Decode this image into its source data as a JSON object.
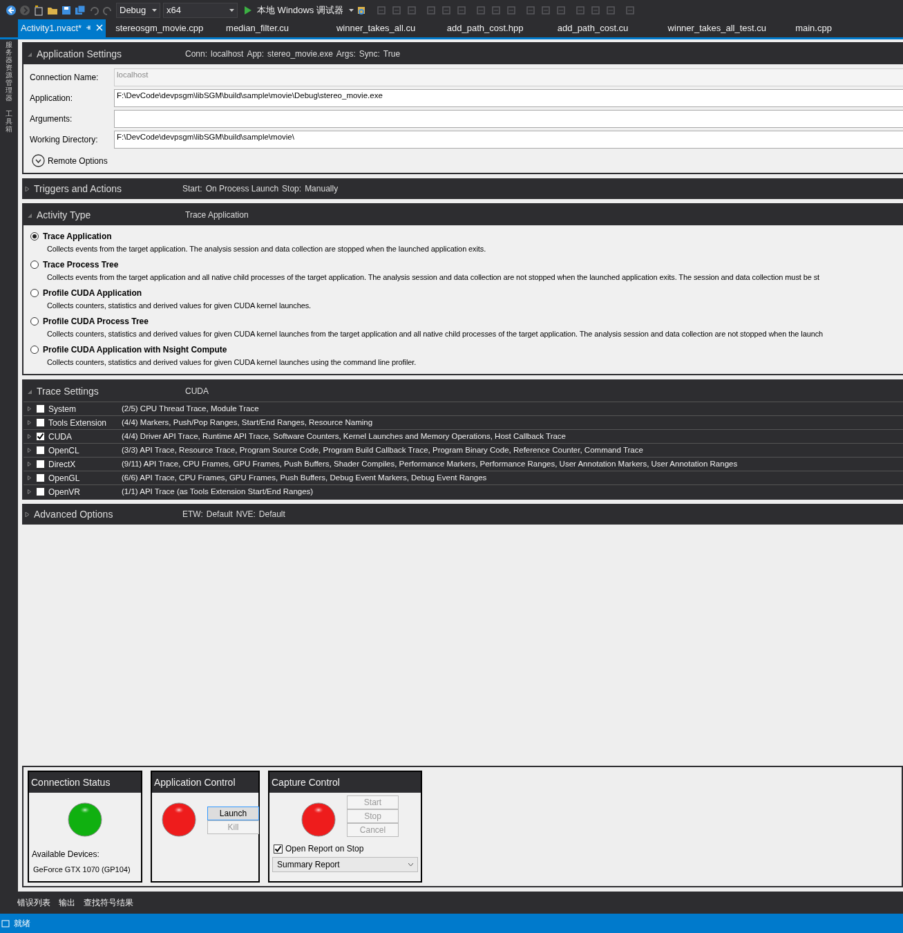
{
  "toolbar": {
    "configuration": "Debug",
    "platform": "x64",
    "debugger": "本地 Windows 调试器"
  },
  "side_panels": [
    "服务器资源管理器",
    "工具箱"
  ],
  "tabs": [
    {
      "label": "Activity1.nvact*",
      "selected": true
    },
    {
      "label": "stereosgm_movie.cpp",
      "selected": false
    },
    {
      "label": "median_filter.cu",
      "selected": false
    },
    {
      "label": "winner_takes_all.cu",
      "selected": false
    },
    {
      "label": "add_path_cost.hpp",
      "selected": false
    },
    {
      "label": "add_path_cost.cu",
      "selected": false
    },
    {
      "label": "winner_takes_all_test.cu",
      "selected": false
    },
    {
      "label": "main.cpp",
      "selected": false
    }
  ],
  "sections": [
    {
      "kind": "settings",
      "title": "Application Settings",
      "expanded": true,
      "summary": [
        {
          "label": "Conn:",
          "value": "localhost"
        },
        {
          "label": "App:",
          "value": "stereo_movie.exe"
        },
        {
          "label": "Args:"
        },
        {
          "label": "Sync:",
          "value": "True"
        }
      ],
      "fields": [
        {
          "label": "Connection Name:",
          "value": "localhost",
          "disabled": true
        },
        {
          "label": "Application:",
          "value": "F:\\DevCode\\devpsgm\\libSGM\\build\\sample\\movie\\Debug\\stereo_movie.exe",
          "disabled": false
        },
        {
          "label": "Arguments:",
          "disabled": false
        },
        {
          "label": "Working Directory:",
          "value": "F:\\DevCode\\devpsgm\\libSGM\\build\\sample\\movie\\",
          "disabled": false
        }
      ],
      "remote_options": {
        "label": "Remote Options",
        "expanded": false
      }
    },
    {
      "kind": "collapsed",
      "title": "Triggers and Actions",
      "expanded": false,
      "summary": [
        {
          "label": "Start:",
          "value": "On Process Launch"
        },
        {
          "label": "Stop:",
          "value": "Manually"
        }
      ]
    },
    {
      "kind": "activity",
      "title": "Activity Type",
      "expanded": true,
      "summary": [
        {
          "value": "Trace Application"
        }
      ],
      "options": [
        {
          "title": "Trace Application",
          "description": "Collects events from the target application. The analysis session and data collection are stopped when the launched application exits.",
          "selected": true
        },
        {
          "title": "Trace Process Tree",
          "description": "Collects events from the target application and all native child processes of the target application. The analysis session and data collection are not stopped when the launched application exits. The session and data collection must be st",
          "selected": false
        },
        {
          "title": "Profile CUDA Application",
          "description": "Collects counters, statistics and derived values for given CUDA kernel launches.",
          "selected": false
        },
        {
          "title": "Profile CUDA Process Tree",
          "description": "Collects counters, statistics and derived values for given CUDA kernel launches from the target application and all native child processes of the target application. The analysis session and data collection are not stopped when the launch",
          "selected": false
        },
        {
          "title": "Profile CUDA Application with Nsight Compute",
          "description": "Collects counters, statistics and derived values for given CUDA kernel launches using the command line profiler.",
          "selected": false
        }
      ]
    },
    {
      "kind": "trace",
      "title": "Trace Settings",
      "expanded": true,
      "summary": [
        {
          "value": "CUDA"
        }
      ],
      "rows": [
        {
          "name": "System",
          "checked": false,
          "details": "(2/5) CPU Thread Trace, Module Trace"
        },
        {
          "name": "Tools Extension",
          "checked": false,
          "details": "(4/4) Markers, Push/Pop Ranges, Start/End Ranges, Resource Naming"
        },
        {
          "name": "CUDA",
          "checked": true,
          "details": "(4/4) Driver API Trace, Runtime API Trace, Software Counters, Kernel Launches and Memory Operations, Host Callback Trace"
        },
        {
          "name": "OpenCL",
          "checked": false,
          "details": "(3/3) API Trace, Resource Trace, Program Source Code, Program Build Callback Trace, Program Binary Code, Reference Counter, Command Trace"
        },
        {
          "name": "DirectX",
          "checked": false,
          "details": "(9/11) API Trace, CPU Frames, GPU Frames, Push Buffers, Shader Compiles, Performance Markers, Performance Ranges, User Annotation Markers, User Annotation Ranges"
        },
        {
          "name": "OpenGL",
          "checked": false,
          "details": "(6/6) API Trace, CPU Frames, GPU Frames, Push Buffers, Debug Event Markers, Debug Event Ranges"
        },
        {
          "name": "OpenVR",
          "checked": false,
          "details": "(1/1) API Trace (as Tools Extension Start/End Ranges)"
        }
      ]
    },
    {
      "kind": "collapsed",
      "title": "Advanced Options",
      "expanded": false,
      "summary": [
        {
          "label": "ETW:",
          "value": "Default"
        },
        {
          "label": "NVE:",
          "value": "Default"
        }
      ]
    }
  ],
  "connection_status": {
    "title": "Connection Status",
    "indicator": {
      "color": "#10b010"
    },
    "devices_label": "Available Devices:",
    "device": "GeForce GTX 1070 (GP104)"
  },
  "application_control": {
    "title": "Application Control",
    "indicator": {
      "color": "#ee1c1c"
    },
    "buttons": [
      {
        "label": "Launch",
        "disabled": false
      },
      {
        "label": "Kill",
        "disabled": true
      }
    ]
  },
  "capture_control": {
    "title": "Capture Control",
    "indicator": {
      "color": "#ee1c1c"
    },
    "buttons": [
      {
        "label": "Start",
        "disabled": true
      },
      {
        "label": "Stop",
        "disabled": true
      },
      {
        "label": "Cancel",
        "disabled": true
      }
    ],
    "open_report": {
      "label": "Open Report on Stop",
      "checked": true
    },
    "report_type": "Summary Report"
  },
  "tool_tabs": [
    "错误列表",
    "输出",
    "查找符号结果"
  ],
  "status_bar": {
    "text": "就绪"
  }
}
